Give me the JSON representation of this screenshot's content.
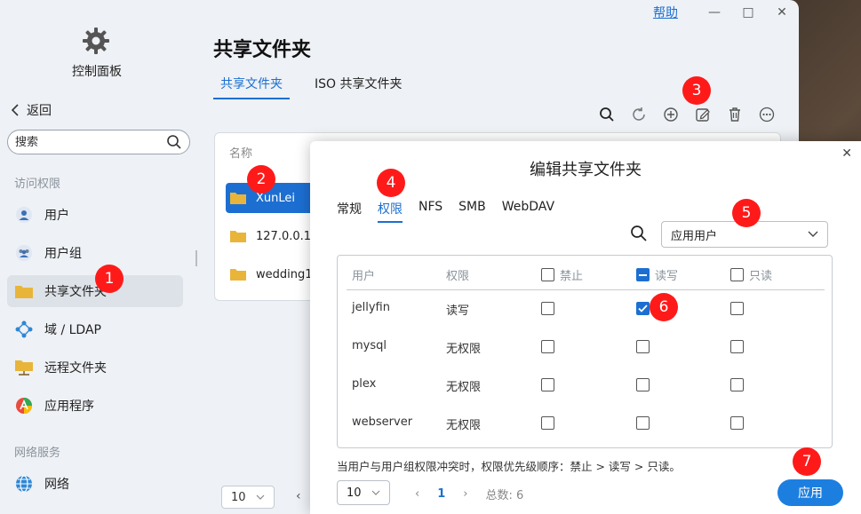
{
  "titlebar": {
    "help": "帮助",
    "minimize": "—",
    "maximize": "□",
    "close": "✕"
  },
  "sidebar": {
    "title": "控制面板",
    "back": "返回",
    "search_placeholder": "搜索",
    "section_access": "访问权限",
    "items": [
      {
        "label": "用户"
      },
      {
        "label": "用户组"
      },
      {
        "label": "共享文件夹"
      },
      {
        "label": "域 / LDAP"
      },
      {
        "label": "远程文件夹"
      },
      {
        "label": "应用程序"
      }
    ],
    "section_network": "网络服务",
    "network_item": "网络"
  },
  "main": {
    "title": "共享文件夹",
    "tabs": [
      "共享文件夹",
      "ISO 共享文件夹"
    ],
    "list_header": "名称",
    "rows": [
      "XunLei",
      "127.0.0.1_",
      "wedding1"
    ],
    "page_size": "10",
    "prev": "‹"
  },
  "dialog": {
    "title": "编辑共享文件夹",
    "close": "✕",
    "tabs": [
      "常规",
      "权限",
      "NFS",
      "SMB",
      "WebDAV"
    ],
    "filter_select": "应用用户",
    "columns": {
      "user": "用户",
      "perm": "权限",
      "deny": "禁止",
      "rw": "读写",
      "ro": "只读"
    },
    "rows": [
      {
        "user": "jellyfin",
        "perm": "读写"
      },
      {
        "user": "mysql",
        "perm": "无权限"
      },
      {
        "user": "plex",
        "perm": "无权限"
      },
      {
        "user": "webserver",
        "perm": "无权限"
      }
    ],
    "note": "当用户与用户组权限冲突时，权限优先级顺序：禁止 > 读写 > 只读。",
    "page_size": "10",
    "page_prev": "‹",
    "page_current": "1",
    "page_next": "›",
    "total": "总数: 6",
    "apply": "应用"
  },
  "markers": [
    "1",
    "2",
    "3",
    "4",
    "5",
    "6",
    "7"
  ],
  "colors": {
    "accent": "#1c6fd1",
    "marker": "#ff1a1a",
    "folder": "#e8b53a"
  }
}
